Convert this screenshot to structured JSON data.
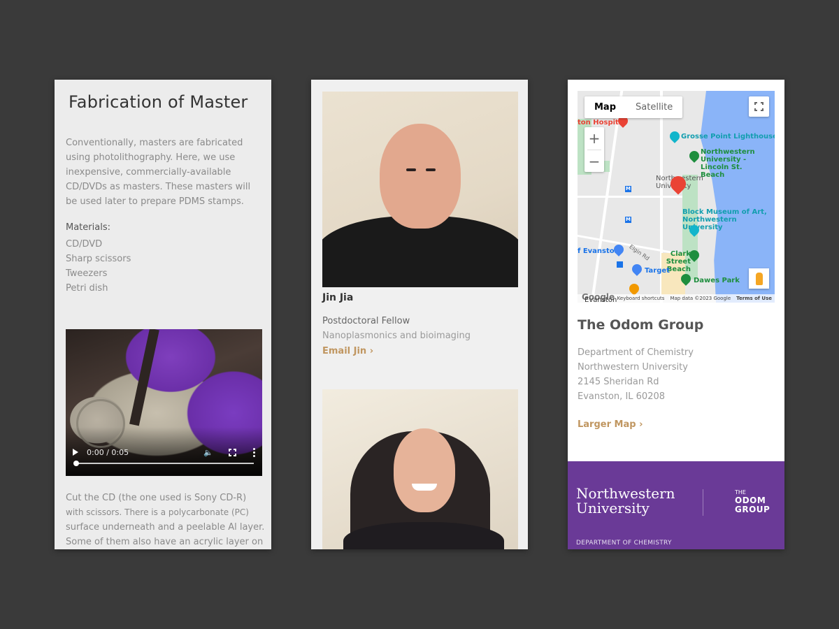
{
  "panel_fabrication": {
    "title": "Fabrication of Master",
    "intro": "Conventionally, masters are fabricated using photolithography. Here, we use inexpensive, commercially-available CD/DVDs as masters. These masters will be used later to prepare PDMS stamps.",
    "materials_heading": "Materials:",
    "materials": [
      "CD/DVD",
      "Sharp scissors",
      "Tweezers",
      "Petri dish"
    ],
    "video": {
      "time": "0:00 / 0:05",
      "progress_fraction": 0.0
    },
    "cut_text_line1": "Cut the CD (the one used is Sony CD-R)",
    "cut_text_line2": "with scissors. There is a polycarbonate (PC)",
    "cut_text_line3": "surface underneath and a peelable Al layer.",
    "cut_text_line4": "Some of them also have an acrylic layer on"
  },
  "panel_people": {
    "people": [
      {
        "name": "Jin Jia",
        "role": "Postdoctoral Fellow",
        "field": "Nanoplasmonics and bioimaging",
        "email_link": "Email Jin ›"
      }
    ]
  },
  "panel_contact": {
    "map": {
      "type_buttons": [
        "Map",
        "Satellite"
      ],
      "active_type": "Map",
      "zoom_in": "+",
      "zoom_out": "−",
      "pois": {
        "hospital": "ton Hospital",
        "lighthouse": "Grosse Point Lighthouse",
        "beach": "Northwestern University - Lincoln St. Beach",
        "nu": "Northwestern University",
        "museum": "Block Museum of Art, Northwestern University",
        "library": "f Evanston",
        "clark": "Clark Street Beach",
        "target": "Target",
        "dawes": "Dawes Park",
        "elgin": "Elgin Rd",
        "evanston": "Evanston"
      },
      "metro_label": "M",
      "google": "Google",
      "footer_links": [
        "Keyboard shortcuts",
        "Map data ©2023 Google",
        "Terms of Use"
      ]
    },
    "org_title": "The Odom Group",
    "address": [
      "Department of Chemistry",
      "Northwestern University",
      "2145 Sheridan Rd",
      "Evanston, IL 60208"
    ],
    "larger_map": "Larger Map ›",
    "footer": {
      "nu_line1": "Northwestern",
      "nu_line2": "University",
      "odom_the": "THE",
      "odom_line1": "ODOM",
      "odom_line2": "GROUP",
      "dept": "DEPARTMENT OF CHEMISTRY",
      "brand_color": "#6a3a97"
    }
  },
  "colors": {
    "link": "#c09660",
    "background": "#3a3a3a"
  }
}
